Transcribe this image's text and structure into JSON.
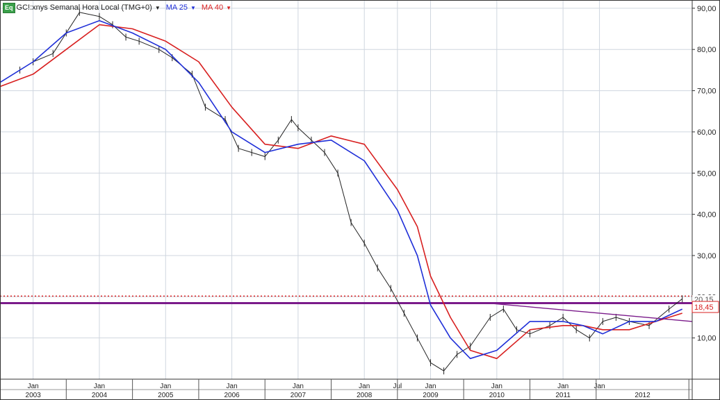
{
  "legend": {
    "badge": "Eq",
    "instrument": "GC!:xnys Semanal Hora Local (TMG+0)",
    "ma1_label": "MA 25",
    "ma2_label": "MA 40",
    "ma1_color": "#1f2fd8",
    "ma2_color": "#d81f1f",
    "dropdown_icon": "triangle-down-icon"
  },
  "price_labels": {
    "dotted_level": "20,15",
    "current": "18,45"
  },
  "chart_data": {
    "type": "line",
    "title": "",
    "xlabel": "",
    "ylabel": "",
    "ylim": [
      0,
      92
    ],
    "y_ticks": [
      "10,00",
      "20,00",
      "30,00",
      "40,00",
      "50,00",
      "60,00",
      "70,00",
      "80,00",
      "90,00"
    ],
    "x_month_ticks": [
      "Jan",
      "Jan",
      "Jan",
      "Jan",
      "Jan",
      "Jan",
      "Jul",
      "Jan",
      "Jan",
      "Jan",
      "Jan"
    ],
    "x_year_ticks": [
      "2003",
      "2004",
      "2005",
      "2006",
      "2007",
      "2008",
      "2009",
      "2010",
      "2011",
      "2012"
    ],
    "grid": true,
    "horizontal_levels": [
      {
        "value": 20.15,
        "style": "dotted",
        "color": "#d81f1f"
      },
      {
        "value": 18.45,
        "style": "solid",
        "color": "#7a1a8a"
      }
    ],
    "series": [
      {
        "name": "MA 25",
        "color": "#1f2fd8",
        "x": [
          2002.5,
          2003.0,
          2003.5,
          2004.0,
          2004.5,
          2005.0,
          2005.5,
          2006.0,
          2006.5,
          2007.0,
          2007.5,
          2008.0,
          2008.5,
          2008.8,
          2009.0,
          2009.3,
          2009.6,
          2010.0,
          2010.5,
          2011.0,
          2011.3,
          2011.6,
          2012.0,
          2012.4,
          2012.8
        ],
        "values": [
          72,
          77,
          84,
          87,
          84,
          80,
          72,
          60,
          55,
          57,
          58,
          53,
          41,
          30,
          18,
          10,
          5,
          7,
          14,
          14,
          13,
          11,
          14,
          14,
          17
        ]
      },
      {
        "name": "MA 40",
        "color": "#d81f1f",
        "x": [
          2002.5,
          2003.0,
          2003.5,
          2004.0,
          2004.5,
          2005.0,
          2005.5,
          2006.0,
          2006.5,
          2007.0,
          2007.5,
          2008.0,
          2008.5,
          2008.8,
          2009.0,
          2009.3,
          2009.6,
          2010.0,
          2010.5,
          2011.0,
          2011.3,
          2011.6,
          2012.0,
          2012.4,
          2012.8
        ],
        "values": [
          71,
          74,
          80,
          86,
          85,
          82,
          77,
          66,
          57,
          56,
          59,
          57,
          46,
          37,
          25,
          15,
          7,
          5,
          12,
          13,
          13,
          12,
          12,
          14,
          16
        ]
      },
      {
        "name": "",
        "color": "#222222",
        "x": [
          2002.5,
          2002.8,
          2003.0,
          2003.3,
          2003.5,
          2003.7,
          2004.0,
          2004.2,
          2004.4,
          2004.6,
          2004.9,
          2005.1,
          2005.4,
          2005.6,
          2005.9,
          2006.1,
          2006.3,
          2006.5,
          2006.7,
          2006.9,
          2007.0,
          2007.2,
          2007.4,
          2007.6,
          2007.8,
          2008.0,
          2008.2,
          2008.4,
          2008.6,
          2008.8,
          2009.0,
          2009.2,
          2009.4,
          2009.6,
          2009.9,
          2010.1,
          2010.3,
          2010.5,
          2010.8,
          2011.0,
          2011.2,
          2011.4,
          2011.6,
          2011.8,
          2012.0,
          2012.3,
          2012.6,
          2012.8
        ],
        "values": [
          72,
          75,
          77,
          79,
          84,
          89,
          88,
          86,
          83,
          82,
          80,
          78,
          74,
          66,
          63,
          56,
          55,
          54,
          58,
          63,
          61,
          58,
          55,
          50,
          38,
          33,
          27,
          22,
          16,
          10,
          4,
          2,
          6,
          8,
          15,
          17,
          12,
          11,
          13,
          15,
          12,
          10,
          14,
          15,
          14,
          13,
          17,
          19.5
        ]
      }
    ],
    "trendlines": [
      {
        "color": "#7a1a8a",
        "x": [
          2009.9,
          2012.95
        ],
        "values": [
          18.4,
          14.0
        ]
      }
    ]
  }
}
